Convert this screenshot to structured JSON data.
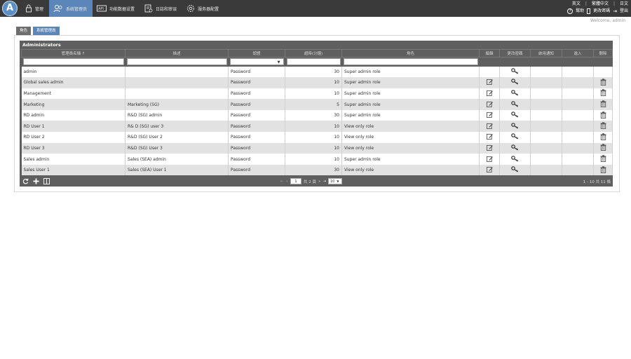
{
  "nav": {
    "logo": "A",
    "items": [
      {
        "label": "管理",
        "icon": "lock-icon"
      },
      {
        "label": "系统管理员",
        "icon": "users-icon"
      },
      {
        "label": "功能数据设置",
        "icon": "api-icon"
      },
      {
        "label": "日誌和审误",
        "icon": "log-icon"
      },
      {
        "label": "服务器配置",
        "icon": "gear-icon"
      }
    ]
  },
  "top_right": {
    "lang1": "英文",
    "lang2": "繁體中文",
    "lang3": "日文",
    "help": "幫助",
    "change_password": "更改密碼",
    "logout": "登出"
  },
  "welcome": "Welcome, admin",
  "tabs": [
    {
      "label": "角色"
    },
    {
      "label": "系統管理員"
    }
  ],
  "grid": {
    "title": "Administrators",
    "columns": [
      "管理員名稱 ↑",
      "描述",
      "認證",
      "超時(分鐘)",
      "角色",
      "編輯",
      "更改密碼",
      "啟用通知",
      "進入",
      "刪除"
    ],
    "rows": [
      {
        "name": "admin",
        "desc": "",
        "auth": "Password",
        "timeout": "30",
        "role": "Super admin role",
        "editable": false,
        "deletable": false
      },
      {
        "name": "Global sales admin",
        "desc": "",
        "auth": "Password",
        "timeout": "10",
        "role": "Super admin role",
        "editable": true,
        "deletable": true
      },
      {
        "name": "Management",
        "desc": "",
        "auth": "Password",
        "timeout": "10",
        "role": "Super admin role",
        "editable": true,
        "deletable": true
      },
      {
        "name": "Marketing",
        "desc": "Marketing (SG)",
        "auth": "Password",
        "timeout": "5",
        "role": "Super admin role",
        "editable": true,
        "deletable": true
      },
      {
        "name": "RD admin",
        "desc": "R&D (SG) admin",
        "auth": "Password",
        "timeout": "30",
        "role": "Super admin role",
        "editable": true,
        "deletable": true
      },
      {
        "name": "RD User 1",
        "desc": "R& D (SG) user 3",
        "auth": "Password",
        "timeout": "10",
        "role": "View only role",
        "editable": true,
        "deletable": true
      },
      {
        "name": "RD User 2",
        "desc": "R&D (SG) User 2",
        "auth": "Password",
        "timeout": "10",
        "role": "View only role",
        "editable": true,
        "deletable": true
      },
      {
        "name": "RD User 3",
        "desc": "R&D (SG) User 3",
        "auth": "Password",
        "timeout": "10",
        "role": "View only role",
        "editable": true,
        "deletable": true
      },
      {
        "name": "Sales admin",
        "desc": "Sales (SEA) admin",
        "auth": "Password",
        "timeout": "10",
        "role": "Super admin role",
        "editable": true,
        "deletable": true
      },
      {
        "name": "Sales User 1",
        "desc": "Sales (SEA) User 1",
        "auth": "Password",
        "timeout": "30",
        "role": "View only role",
        "editable": true,
        "deletable": true
      }
    ]
  },
  "pager": {
    "page": "1",
    "of_pages": "共 2 頁",
    "page_size": "10",
    "record_info": "1 - 10 共 11 條"
  }
}
